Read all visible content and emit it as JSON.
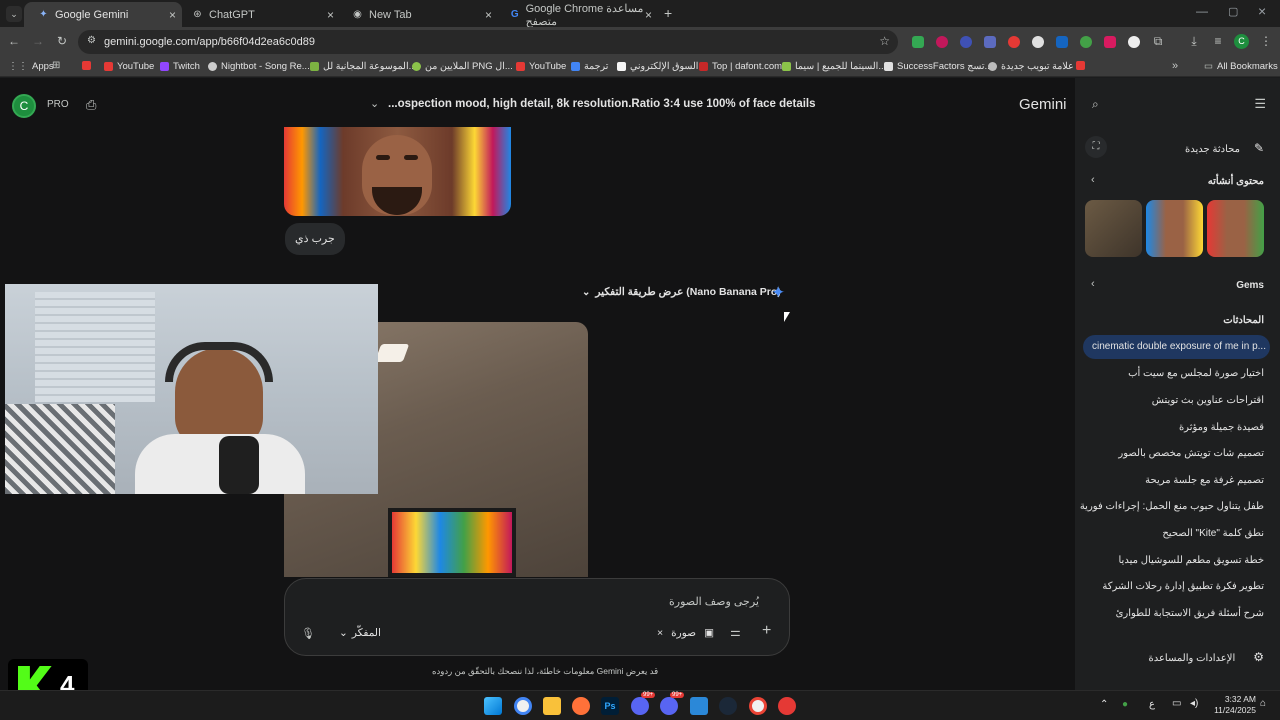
{
  "tabs": [
    {
      "title": "Google Gemini",
      "active": true
    },
    {
      "title": "ChatGPT",
      "active": false
    },
    {
      "title": "New Tab",
      "active": false
    },
    {
      "title": "Google Chrome مساعدة متصفح",
      "active": false
    }
  ],
  "url": "gemini.google.com/app/b66f04d2ea6c0d89",
  "bookmarks": {
    "apps": "Apps",
    "items": [
      "YouTube",
      "Twitch",
      "Nightbot - Song Re...",
      "الموسوعة المجانية لل...",
      "الملايين من PNG ال...",
      "YouTube",
      "ترجمة",
      "السوق الإلكتروني",
      "Top | dafont.com",
      "السينما للجميع | سيما...",
      "SuccessFactors تسج...",
      "علامة تبويب جديدة"
    ],
    "all": "All Bookmarks"
  },
  "gemini": {
    "avatar_letter": "C",
    "plan": "PRO",
    "chat_title": "...ospection mood, high detail, 8k resolution.Ratio 3:4 use 100% of face details",
    "brand": "Gemini",
    "user_message": "جرب ذي",
    "thinking_label": "عرض طريقة التفكير (Nano Banana Pro)",
    "input_placeholder": "يُرجى وصف الصورة",
    "image_chip": "صورة",
    "mode": "المفكّر",
    "disclaimer": "قد يعرض Gemini معلومات خاطئة، لذا ننصحك بالتحقّق من ردوده"
  },
  "sidebar": {
    "new_chat": "محادثة جديدة",
    "my_stuff": "محتوى أنشأته",
    "gems": "Gems",
    "chats_header": "المحادثات",
    "chats": [
      "cinematic double exposure of me in p...",
      "اختيار صورة لمجلس مع سيت أب",
      "اقتراحات عناوين بث تويتش",
      "قصيدة جميلة ومؤثرة",
      "تصميم شات تويتش مخصص بالصور",
      "تصميم غرفة مع جلسة مريحة",
      "طفل يتناول حبوب منع الحمل: إجراءات فورية",
      "نطق كلمة \"Kite\" الصحيح",
      "خطة تسويق مطعم للسوشيال ميديا",
      "تطوير فكرة تطبيق إدارة رحلات الشركة",
      "شرح أسئلة فريق الاستجابة للطوارئ"
    ],
    "settings": "الإعدادات والمساعدة"
  },
  "overlay": {
    "logo_number": "4"
  },
  "taskbar": {
    "time": "3:32 AM",
    "date": "11/24/2025",
    "lang": "ع",
    "badge1": "99+",
    "badge2": "99+"
  },
  "colors": {
    "accent": "#a8c7fa",
    "selected_chat": "#1f3760"
  }
}
